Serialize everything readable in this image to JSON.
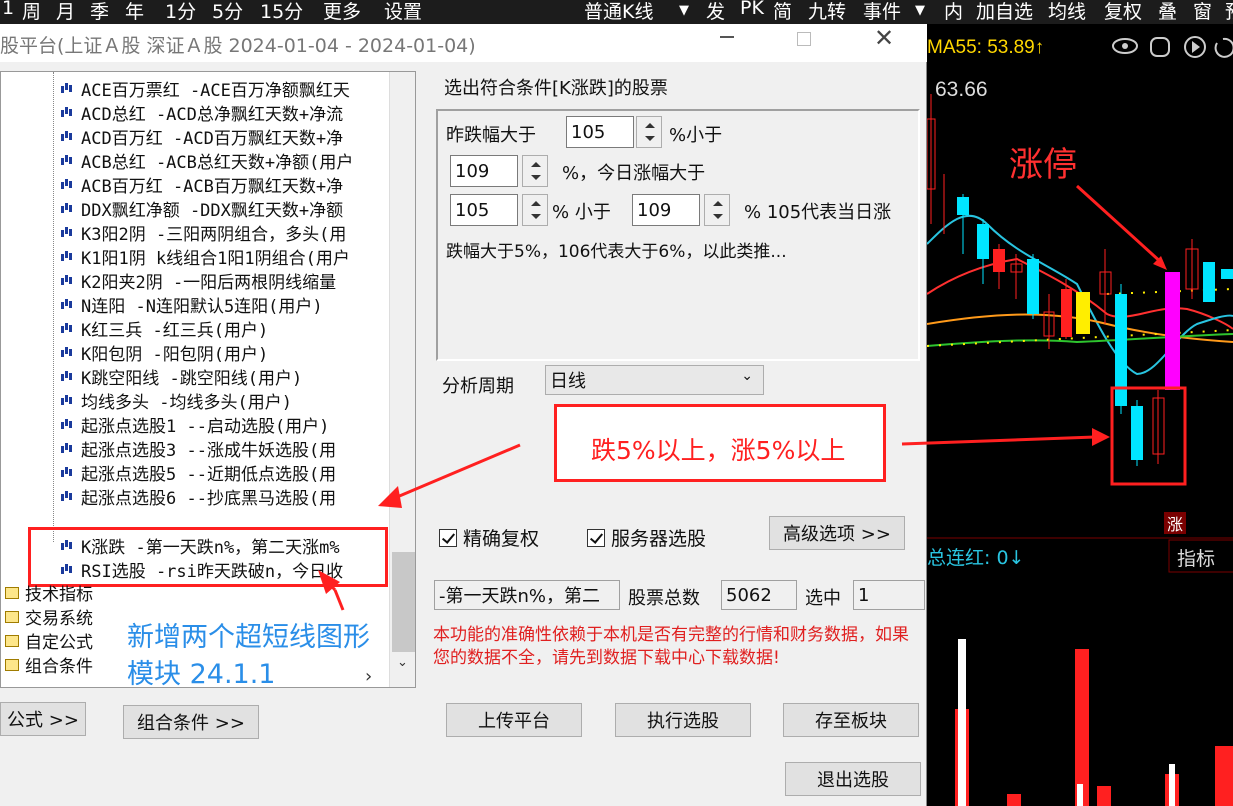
{
  "topbar": {
    "left_items": [
      "1",
      "周",
      "月",
      "季",
      "年",
      "1分",
      "5分",
      "15分",
      "更多",
      "设置"
    ],
    "kline_select": "普通K线",
    "right_items": [
      "发",
      "PK",
      "简",
      "九转",
      "事件"
    ],
    "far_right_items": [
      "内",
      "加自选",
      "均线",
      "复权",
      "叠",
      "窗",
      "预"
    ]
  },
  "dialog": {
    "title": "股平台(上证Ａ股 深证Ａ股   2024-01-04 - 2024-01-04)",
    "tree_items": [
      "ACE百万票红 -ACE百万净额飘红天",
      "ACD总红 -ACD总净飘红天数+净流",
      "ACD百万红 -ACD百万飘红天数+净",
      "ACB总红 -ACB总红天数+净额(用户",
      "ACB百万红 -ACB百万飘红天数+净",
      "DDX飘红净额 -DDX飘红天数+净额",
      "K3阳2阴 -三阳两阴组合，多头(用",
      "K1阳1阴 k线组合1阳1阴组合(用户",
      "K2阳夹2阴 -一阳后两根阴线缩量",
      "N连阳 -N连阳默认5连阳(用户)",
      "K红三兵 -红三兵(用户)",
      "K阳包阴 -阳包阴(用户)",
      "K跳空阳线 -跳空阳线(用户)",
      "均线多头 -均线多头(用户)",
      "起涨点选股1 --启动选股(用户)",
      "起涨点选股3 --涨成牛妖选股(用",
      "起涨点选股5 --近期低点选股(用",
      "起涨点选股6 --抄底黑马选股(用",
      "K涨跌 -第一天跌n%，第二天涨m%",
      "RSI选股 -rsi昨天跌破n，今日收"
    ],
    "categories": [
      "技术指标",
      "交易系统",
      "自定公式",
      "组合条件"
    ],
    "left_buttons": {
      "formula": "公式 >>",
      "combo": "组合条件 >>"
    },
    "section_title": "选出符合条件[K涨跌]的股票",
    "params": {
      "row1_label": "昨跌幅大于",
      "p1": "105",
      "row1_suffix": "%小于",
      "p2": "109",
      "row2_suffix": "%，今日涨幅大于",
      "p3": "105",
      "row3_mid": "%  小于",
      "p4": "109",
      "row3_suffix": "%  105代表当日涨",
      "note": "跌幅大于5%，106代表大于6%，以此类推..."
    },
    "period_label": "分析周期",
    "period_value": "日线",
    "checkbox_exact": "精确复权",
    "checkbox_server": "服务器选股",
    "advanced_button": "高级选项 >>",
    "formula_desc": "-第一天跌n%，第二",
    "total_label": "股票总数",
    "total_value": "5062",
    "selected_label": "选中",
    "selected_value": "1",
    "warning": "本功能的准确性依赖于本机是否有完整的行情和财务数据，如果您的数据不全，请先到数据下载中心下载数据!",
    "upload_button": "上传平台",
    "execute_button": "执行选股",
    "save_button": "存至板块",
    "exit_button": "退出选股"
  },
  "annotations": {
    "new_modules_line1": "新增两个超短线图形",
    "new_modules_line2": "模块  24.1.1",
    "condition_box": "跌5%以上，涨5%以上",
    "limit_up": "涨停"
  },
  "chart": {
    "ma55": "MA55: 53.89↑",
    "price": "63.66",
    "zt_badge": "涨",
    "consecutive": "总连红: 0↓",
    "indicator_btn": "指标",
    "colors": {
      "up": "#ff2020",
      "down": "#00e5ff",
      "limit": "#ff00ff",
      "accent": "#ffd700"
    }
  }
}
